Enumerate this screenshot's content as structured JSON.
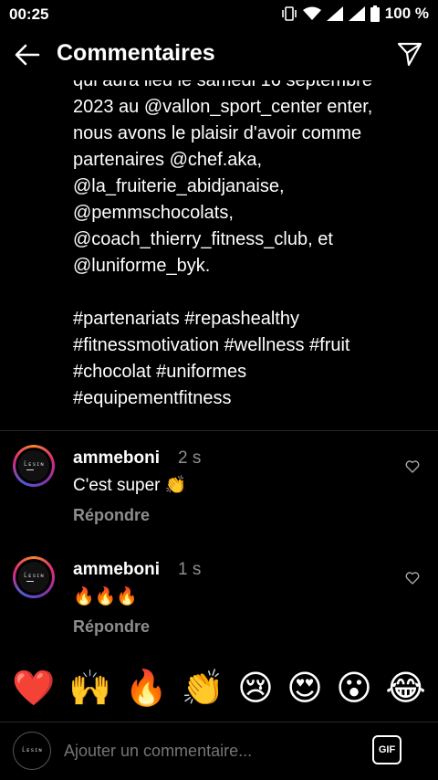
{
  "status": {
    "time": "00:25",
    "battery_text": "100 %",
    "icons": [
      "vibrate-icon",
      "wifi-icon",
      "signal-4g-icon",
      "signal-icon",
      "battery-icon"
    ]
  },
  "header": {
    "title": "Commentaires",
    "back_icon": "arrow-left-icon",
    "send_icon": "paper-plane-icon"
  },
  "caption": {
    "text": "qui aura lieu le samedi 16 septembre\n2023 au @vallon_sport_center enter,\nnous avons le plaisir d'avoir comme\npartenaires @chef.aka,\n@la_fruiterie_abidjanaise,\n@pemmschocolats,\n@coach_thierry_fitness_club, et\n@luniforme_byk.\n\n#partenariats #repashealthy\n#fitnessmotivation #wellness #fruit\n#chocolat #uniformes\n#equipementfitness"
  },
  "comments": [
    {
      "user": "ammeboni",
      "time": "2 s",
      "text": "C'est super 👏",
      "reply": "Répondre"
    },
    {
      "user": "ammeboni",
      "time": "1 s",
      "text": "🔥🔥🔥",
      "reply": "Répondre"
    }
  ],
  "emoji_bar": [
    "❤️",
    "🙌",
    "🔥",
    "👏",
    "😢",
    "😍",
    "😮",
    "😂"
  ],
  "input": {
    "placeholder": "Ajouter un commentaire...",
    "gif_label": "GIF"
  },
  "colors": {
    "background": "#000000",
    "text": "#ffffff",
    "muted": "#8e8e8e"
  }
}
